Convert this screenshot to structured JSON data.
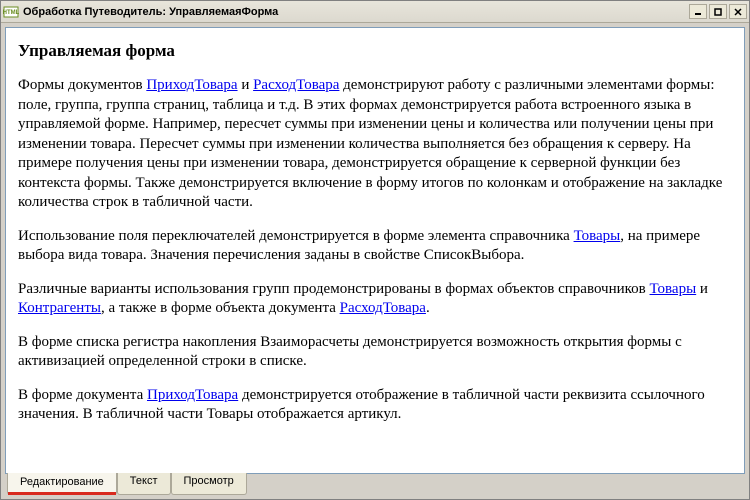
{
  "window": {
    "title": "Обработка Путеводитель: УправляемаяФорма"
  },
  "heading": "Управляемая форма",
  "p1": {
    "t1": "Формы документов ",
    "link1": "ПриходТовара",
    "t2": " и ",
    "link2": "РасходТовара",
    "t3": " демонстрируют работу с различными элементами формы: поле, группа, группа страниц, таблица и т.д. В этих формах демонстрируется работа встроенного языка в управляемой форме. Например, пересчет суммы при изменении цены и количества или получении цены при изменении товара. Пересчет суммы при изменении количества выполняется без обращения к серверу. На примере получения цены при изменении товара, демонстрируется обращение к серверной функции без контекста формы. Также демонстрируется включение в форму итогов по колонкам и отображение на закладке количества строк в табличной части."
  },
  "p2": {
    "t1": "Использование поля переключателей демонстрируется в форме элемента справочника ",
    "link1": "Товары",
    "t2": ", на примере выбора вида товара. Значения перечисления заданы в свойстве СписокВыбора."
  },
  "p3": {
    "t1": "Различные варианты использования групп продемонстрированы в формах объектов справочников ",
    "link1": "Товары",
    "t2": " и ",
    "link2": "Контрагенты",
    "t3": ", а также в форме объекта документа ",
    "link3": "РасходТовара",
    "t4": "."
  },
  "p4": {
    "t1": "В форме списка регистра накопления Взаиморасчеты демонстрируется возможность открытия формы с активизацией определенной строки в списке."
  },
  "p5": {
    "t1": "В форме документа ",
    "link1": "ПриходТовара",
    "t2": " демонстрируется отображение в табличной части реквизита ссылочного значения. В табличной части Товары отображается артикул."
  },
  "tabs": [
    {
      "label": "Редактирование",
      "active": true
    },
    {
      "label": "Текст",
      "active": false
    },
    {
      "label": "Просмотр",
      "active": false
    }
  ]
}
